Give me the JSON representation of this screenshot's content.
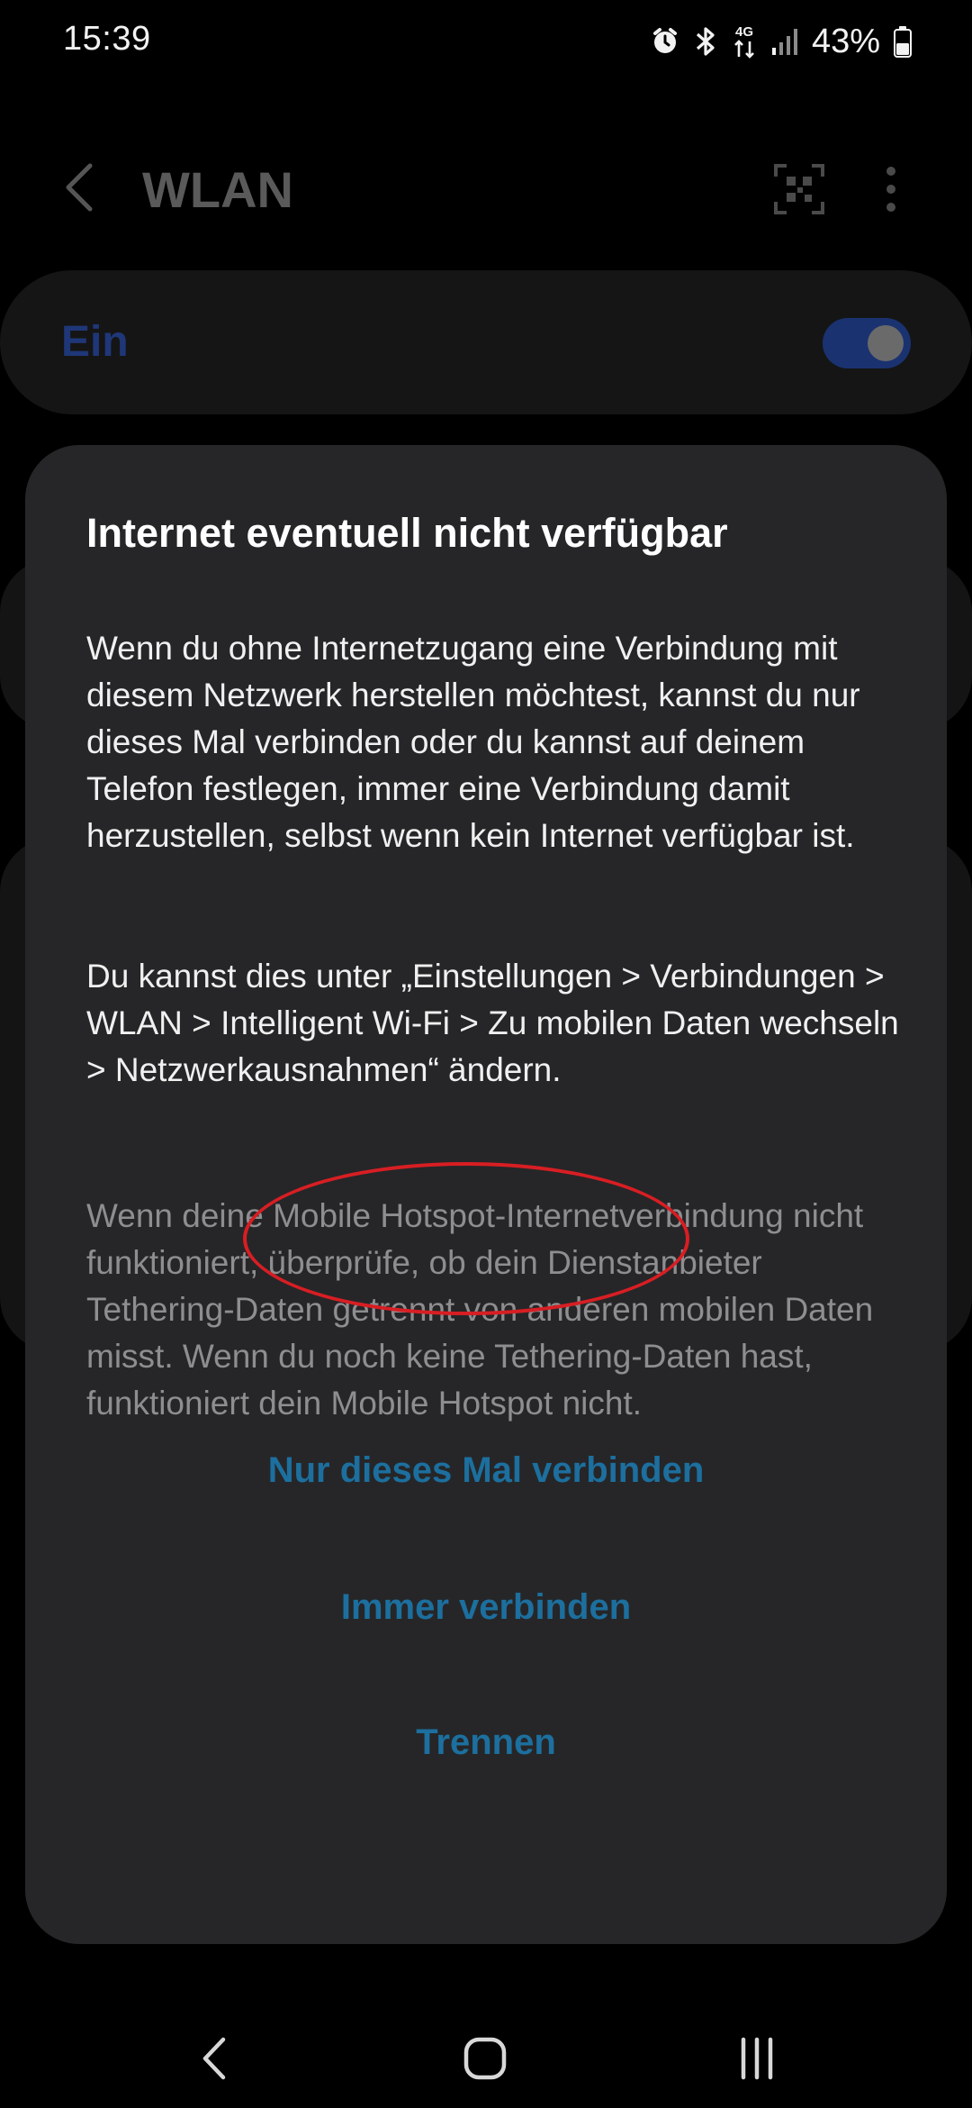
{
  "status_bar": {
    "time": "15:39",
    "network": "4G",
    "battery": "43%"
  },
  "header": {
    "title": "WLAN"
  },
  "wifi": {
    "toggle_label": "Ein",
    "enabled": true
  },
  "dialog": {
    "title": "Internet eventuell nicht verfügbar",
    "paragraph1": "Wenn du ohne Internetzugang eine Verbindung mit diesem Netzwerk herstellen möchtest, kannst du nur dieses Mal verbinden oder du kannst auf deinem Telefon festlegen, immer eine Verbindung damit herzustellen, selbst wenn kein Internet verfügbar ist.",
    "paragraph2": "Du kannst dies unter „Einstellungen > Verbindungen > WLAN > Intelligent Wi-Fi > Zu mobilen Daten wechseln > Netzwerkausnahmen“ ändern.",
    "paragraph3": "Wenn deine Mobile Hotspot-Internetverbindung nicht funktioniert, überprüfe, ob dein Dienstanbieter Tethering-Daten getrennt von anderen mobilen Daten misst. Wenn du noch keine Tethering-Daten hast, funktioniert dein Mobile Hotspot nicht.",
    "actions": {
      "connect_once": "Nur dieses Mal verbinden",
      "always_connect": "Immer verbinden",
      "disconnect": "Trennen"
    }
  },
  "icons": {
    "status": [
      "alarm-icon",
      "bluetooth-icon",
      "mobile-data-icon",
      "signal-icon",
      "battery-icon"
    ],
    "header": [
      "back-icon",
      "qr-code-icon",
      "more-options-icon"
    ],
    "nav": [
      "nav-back-icon",
      "nav-home-icon",
      "nav-recent-icon"
    ]
  },
  "colors": {
    "dialog_background": "#262628",
    "action_text": "#1c6f9e",
    "highlight_ellipse": "#d81e23",
    "toggle_track": "#1a3270"
  }
}
